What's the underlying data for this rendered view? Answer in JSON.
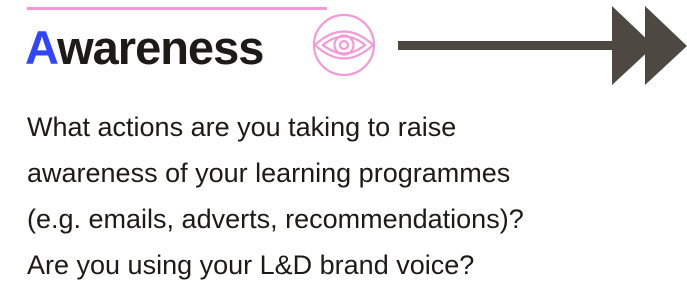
{
  "heading": {
    "initial": "A",
    "rest": "wareness"
  },
  "icon": "eye-icon",
  "body": {
    "lines": [
      "What actions are you taking to raise",
      "awareness of your learning programmes",
      "(e.g. emails, adverts, recommendations)?",
      "Are you using your L&D brand voice?"
    ]
  },
  "colors": {
    "accent_rule": "#f39ad6",
    "eye_icon": "#f39ad6",
    "title_initial": "#2f45ff",
    "text": "#1d1b17",
    "arrow": "#4d4942"
  }
}
